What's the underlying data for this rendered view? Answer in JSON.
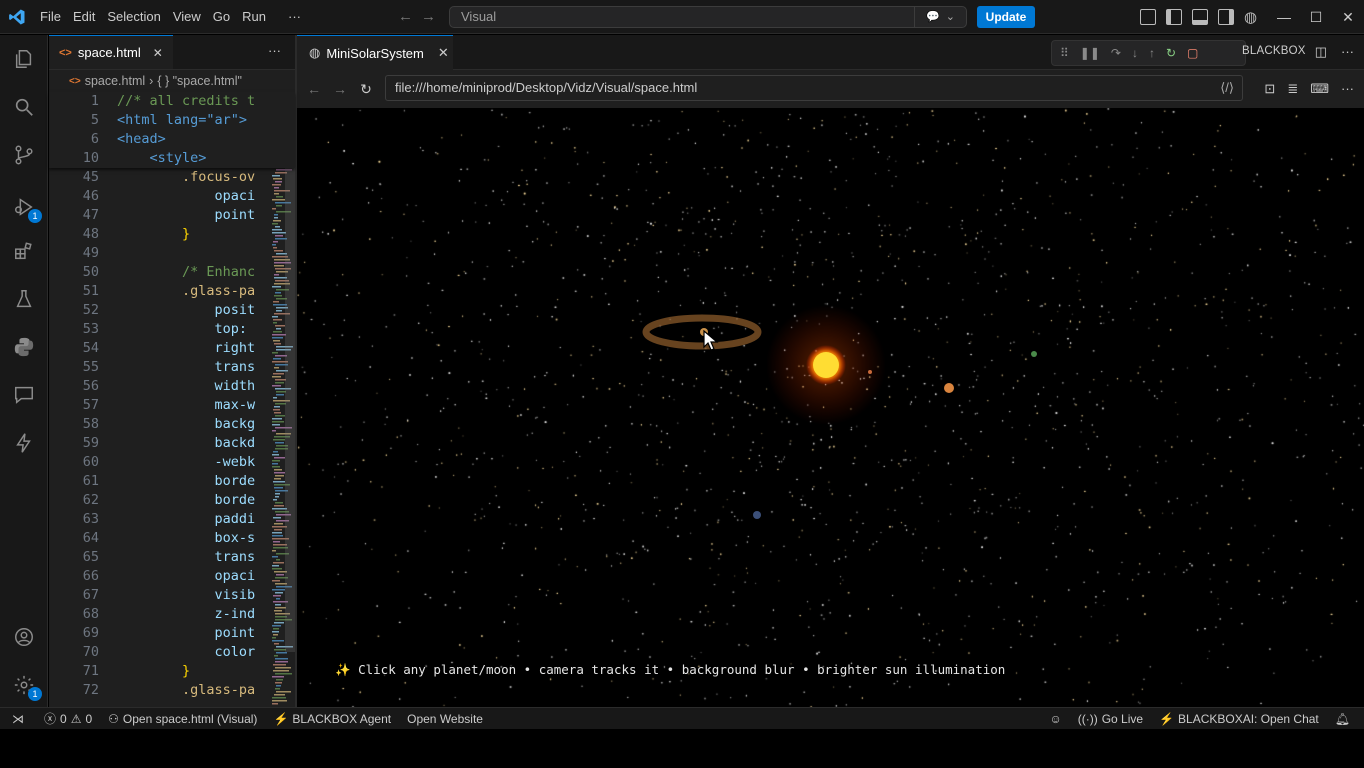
{
  "titlebar": {
    "menu": [
      "File",
      "Edit",
      "Selection",
      "View",
      "Go",
      "Run",
      "···"
    ],
    "command_center": "Visual",
    "update_label": "Update"
  },
  "activitybar": {
    "items": [
      "explorer-icon",
      "search-icon",
      "source-control-icon",
      "run-debug-icon",
      "extensions-icon",
      "testing-icon",
      "python-icon",
      "chat-icon",
      "blackbox-icon"
    ],
    "debug_badge": "1",
    "settings_badge": "1"
  },
  "editor": {
    "tab_label": "space.html",
    "breadcrumb": {
      "file": "space.html",
      "symbol": "{ } \"space.html\""
    },
    "sticky_lines": [
      {
        "num": "1",
        "text": "//* all credits t"
      },
      {
        "num": "5",
        "text": "<html lang=\"ar\">"
      },
      {
        "num": "6",
        "text": "<head>"
      },
      {
        "num": "10",
        "text": "    <style>"
      }
    ],
    "lines": [
      {
        "num": "45",
        "text": "        .focus-ov"
      },
      {
        "num": "46",
        "text": "            opaci"
      },
      {
        "num": "47",
        "text": "            point"
      },
      {
        "num": "48",
        "text": "        }"
      },
      {
        "num": "49",
        "text": ""
      },
      {
        "num": "50",
        "text": "        /* Enhanc"
      },
      {
        "num": "51",
        "text": "        .glass-pa"
      },
      {
        "num": "52",
        "text": "            posit"
      },
      {
        "num": "53",
        "text": "            top: "
      },
      {
        "num": "54",
        "text": "            right"
      },
      {
        "num": "55",
        "text": "            trans"
      },
      {
        "num": "56",
        "text": "            width"
      },
      {
        "num": "57",
        "text": "            max-w"
      },
      {
        "num": "58",
        "text": "            backg"
      },
      {
        "num": "59",
        "text": "            backd"
      },
      {
        "num": "60",
        "text": "            -webk"
      },
      {
        "num": "61",
        "text": "            borde"
      },
      {
        "num": "62",
        "text": "            borde"
      },
      {
        "num": "63",
        "text": "            paddi"
      },
      {
        "num": "64",
        "text": "            box-s"
      },
      {
        "num": "65",
        "text": "            trans"
      },
      {
        "num": "66",
        "text": "            opaci"
      },
      {
        "num": "67",
        "text": "            visib"
      },
      {
        "num": "68",
        "text": "            z-ind"
      },
      {
        "num": "69",
        "text": "            point"
      },
      {
        "num": "70",
        "text": "            color"
      },
      {
        "num": "71",
        "text": "        }"
      },
      {
        "num": "72",
        "text": "        .glass-pa"
      }
    ]
  },
  "browser": {
    "tab_label": "MiniSolarSystem",
    "debug_label": "BLACKBOX",
    "url": "file:///home/miniprod/Desktop/Vidz/Visual/space.html",
    "hint": "✨ Click any planet/moon • camera tracks it • background blur • brighter sun illumination"
  },
  "statusbar": {
    "errors": "0",
    "warnings": "0",
    "open_file": "Open space.html (Visual)",
    "agent": "BLACKBOX Agent",
    "open_website": "Open Website",
    "go_live": "Go Live",
    "open_chat": "BLACKBOXAI: Open Chat"
  },
  "colors": {
    "accent": "#0078d4",
    "sun": "#ffcc22",
    "background": "#000000"
  }
}
